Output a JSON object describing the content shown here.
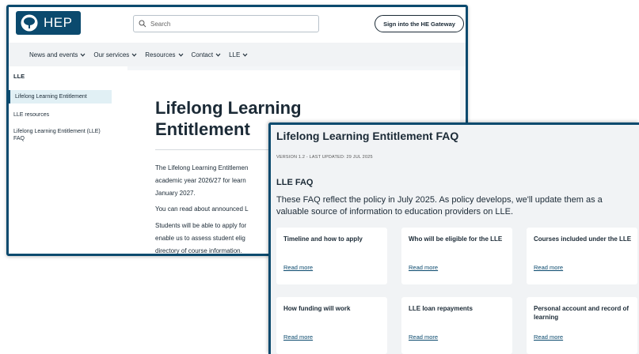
{
  "header": {
    "logo_text": "HEP",
    "search_placeholder": "Search",
    "gateway_button": "Sign into the HE Gateway"
  },
  "nav": {
    "items": [
      {
        "label": "News and events"
      },
      {
        "label": "Our services"
      },
      {
        "label": "Resources"
      },
      {
        "label": "Contact"
      },
      {
        "label": "LLE"
      }
    ]
  },
  "sidebar": {
    "title": "LLE",
    "items": [
      {
        "label": "Lifelong Learning Entitlement"
      },
      {
        "label": "LLE resources"
      },
      {
        "label": "Lifelong Learning Entitlement (LLE) FAQ"
      }
    ]
  },
  "main": {
    "title": "Lifelong Learning Entitlement",
    "paragraphs": [
      "The Lifelong Learning Entitlemen",
      "academic year 2026/27 for learn",
      "January 2027.",
      "You can read about announced L",
      "Students will be able to apply for",
      "enable us to assess student elig",
      "directory of course information."
    ]
  },
  "faq": {
    "title": "Lifelong Learning Entitlement FAQ",
    "version": "VERSION 1.2 - LAST UPDATED: 29 JUL 2025",
    "section_title": "LLE FAQ",
    "intro": "These FAQ reflect the policy in July 2025. As policy develops, we'll update them as a valuable source of information to education providers on LLE.",
    "cards": [
      {
        "title": "Timeline and how to apply",
        "link": "Read more"
      },
      {
        "title": "Who will be eligible for the LLE",
        "link": "Read more"
      },
      {
        "title": "Courses included under the LLE",
        "link": "Read more"
      },
      {
        "title": "How funding will work",
        "link": "Read more"
      },
      {
        "title": "LLE loan repayments",
        "link": "Read more"
      },
      {
        "title": "Personal account and record of learning",
        "link": "Read more"
      }
    ]
  },
  "colors": {
    "brand": "#0b4a6e",
    "text": "#1b2a36",
    "nav_bg": "#f1f3f5"
  }
}
